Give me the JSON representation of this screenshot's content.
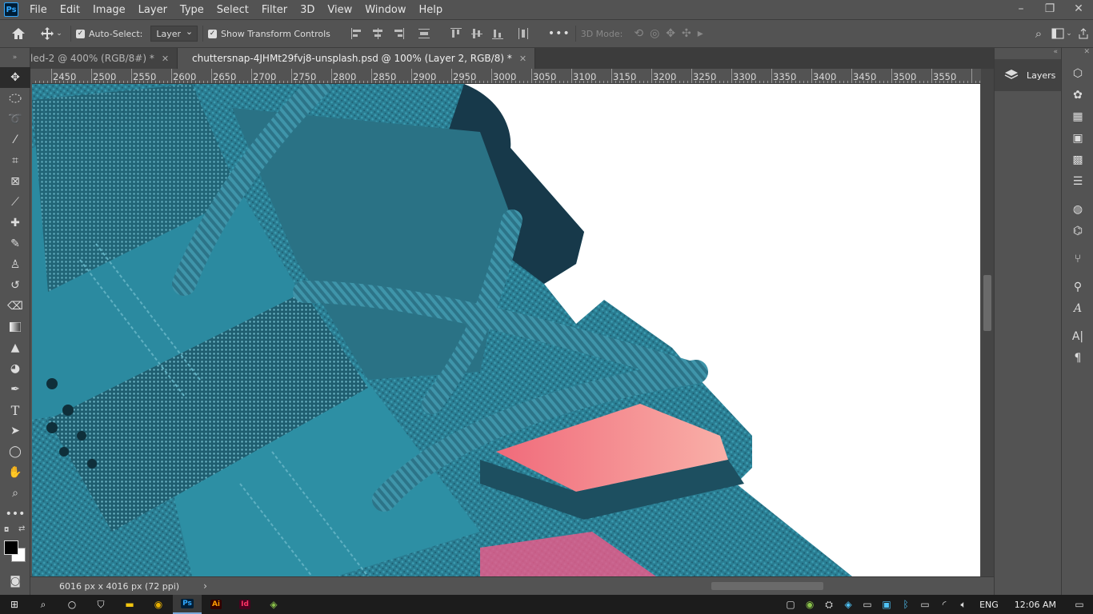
{
  "app": {
    "logo": "Ps"
  },
  "menu": [
    "File",
    "Edit",
    "Image",
    "Layer",
    "Type",
    "Select",
    "Filter",
    "3D",
    "View",
    "Window",
    "Help"
  ],
  "window_controls": {
    "minimize": "–",
    "restore": "❐",
    "close": "✕"
  },
  "options": {
    "auto_select_label": "Auto-Select:",
    "auto_select_value": "Layer",
    "show_transform_label": "Show Transform Controls",
    "three_d_mode_label": "3D Mode:",
    "more_label": "•••"
  },
  "tabs": [
    {
      "label": "led-2 @ 400% (RGB/8#) *",
      "active": false
    },
    {
      "label": "chuttersnap-4JHMt29fvj8-unsplash.psd @ 100% (Layer 2, RGB/8) *",
      "active": true
    }
  ],
  "ruler_top": {
    "labels": [
      "2450",
      "2500",
      "2550",
      "2600",
      "2650",
      "2700",
      "2750",
      "2800",
      "2850",
      "2900",
      "2950",
      "3000",
      "3050",
      "3100",
      "3150",
      "3200",
      "3250",
      "3300",
      "3350",
      "3400",
      "3450",
      "3500",
      "3550"
    ]
  },
  "status": {
    "doc_size": "6016 px x 4016 px (72 ppi)",
    "arrow": "›"
  },
  "panels": {
    "layers_label": "Layers"
  },
  "taskbar": {
    "apps": [
      {
        "name": "start",
        "glyph": "⊞"
      },
      {
        "name": "search",
        "glyph": "⌕"
      },
      {
        "name": "cortana",
        "glyph": "○"
      },
      {
        "name": "defender",
        "glyph": "⛉"
      },
      {
        "name": "explorer",
        "glyph": "▬"
      },
      {
        "name": "chrome",
        "glyph": "◉"
      },
      {
        "name": "photoshop",
        "glyph": "Ps"
      },
      {
        "name": "illustrator",
        "glyph": "Ai"
      },
      {
        "name": "indesign",
        "glyph": "Id"
      },
      {
        "name": "app",
        "glyph": "◈"
      }
    ],
    "language": "ENG",
    "time": "12:06 AM"
  },
  "colors": {
    "ps_blue": "#31a8ff",
    "ui_bg": "#535353",
    "taskbar": "#1c1c1c",
    "shoe_teal": "#2f8ea3"
  }
}
